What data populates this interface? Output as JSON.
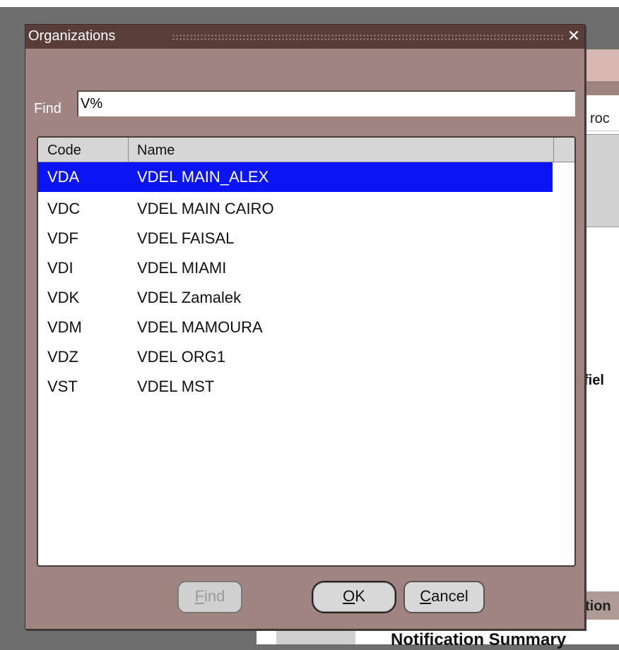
{
  "background": {
    "partial_label_1": "roc",
    "partial_label_2": "fiel",
    "partial_label_3": "tion",
    "partial_heading": "Notification Summary"
  },
  "dialog": {
    "title": "Organizations",
    "close_icon": "close-icon",
    "find_label": "Find",
    "find_value": "V%",
    "columns": [
      "Code",
      "Name"
    ],
    "rows": [
      {
        "code": "VDA",
        "name": "VDEL MAIN_ALEX",
        "selected": true
      },
      {
        "code": "VDC",
        "name": "VDEL MAIN CAIRO"
      },
      {
        "code": "VDF",
        "name": "VDEL FAISAL"
      },
      {
        "code": "VDI",
        "name": "VDEL MIAMI"
      },
      {
        "code": "VDK",
        "name": "VDEL Zamalek"
      },
      {
        "code": "VDM",
        "name": "VDEL MAMOURA"
      },
      {
        "code": "VDZ",
        "name": "VDEL ORG1"
      },
      {
        "code": "VST",
        "name": "VDEL MST"
      }
    ],
    "buttons": {
      "find": {
        "mnemonic": "F",
        "rest": "ind",
        "enabled": false
      },
      "ok": {
        "mnemonic": "O",
        "rest": "K"
      },
      "cancel": {
        "mnemonic": "C",
        "rest": "ancel"
      }
    },
    "colors": {
      "titlebar": "#593d39",
      "body": "#a08481",
      "selection": "#0a14f4"
    }
  }
}
